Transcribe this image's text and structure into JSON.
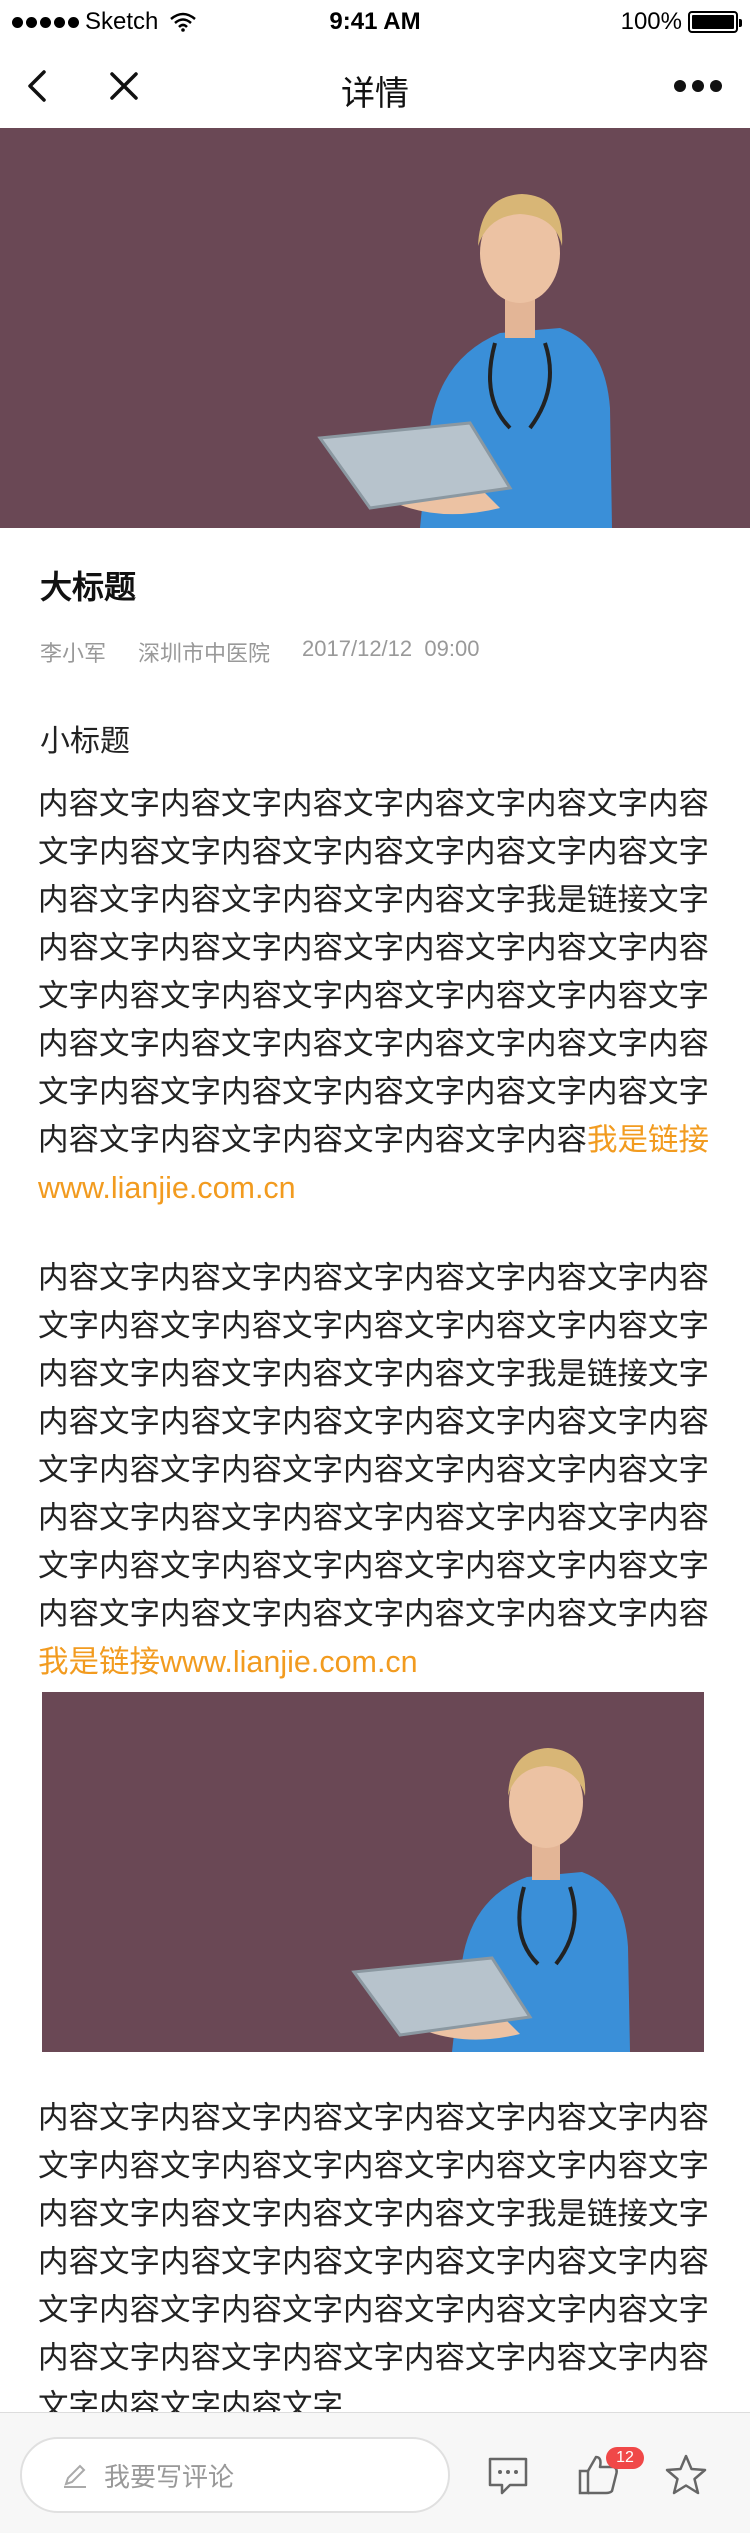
{
  "status_bar": {
    "carrier": "Sketch",
    "time": "9:41 AM",
    "battery": "100%"
  },
  "nav": {
    "title": "详情"
  },
  "article": {
    "title": "大标题",
    "author": "李小军",
    "hospital": "深圳市中医院",
    "date": "2017/12/12",
    "time": "09:00",
    "section_title": "小标题",
    "paragraph1": "内容文字内容文字内容文字内容文字内容文字内容文字内容文字内容文字内容文字内容文字内容文字内容文字内容文字内容文字内容文字我是链接文字内容文字内容文字内容文字内容文字内容文字内容文字内容文字内容文字内容文字内容文字内容文字内容文字内容文字内容文字内容文字内容文字内容文字内容文字内容文字内容文字内容文字内容文字内容文字内容文字内容文字内容文字内容",
    "paragraph1_link": "我是链接www.lianjie.com.cn",
    "paragraph2": "内容文字内容文字内容文字内容文字内容文字内容文字内容文字内容文字内容文字内容文字内容文字内容文字内容文字内容文字内容文字我是链接文字内容文字内容文字内容文字内容文字内容文字内容文字内容文字内容文字内容文字内容文字内容文字内容文字内容文字内容文字内容文字内容文字内容文字内容文字内容文字内容文字内容文字内容文字内容文字内容文字内容文字内容文字内容文字内容",
    "paragraph2_link": "我是链接www.lianjie.com.cn",
    "paragraph3": "内容文字内容文字内容文字内容文字内容文字内容文字内容文字内容文字内容文字内容文字内容文字内容文字内容文字内容文字内容文字我是链接文字内容文字内容文字内容文字内容文字内容文字内容文字内容文字内容文字内容文字内容文字内容文字内容文字内容文字内容文字内容文字内容文字内容文字内容文字内容文字"
  },
  "bottom_bar": {
    "comment_placeholder": "我要写评论",
    "like_count": "12"
  },
  "colors": {
    "link": "#f29b1f",
    "image_background": "#6a4855",
    "badge": "#f04848"
  },
  "icons": [
    "signal-dots-icon",
    "wifi-icon",
    "battery-icon",
    "back-icon",
    "close-icon",
    "more-icon",
    "pencil-icon",
    "comment-icon",
    "like-icon",
    "star-icon"
  ]
}
